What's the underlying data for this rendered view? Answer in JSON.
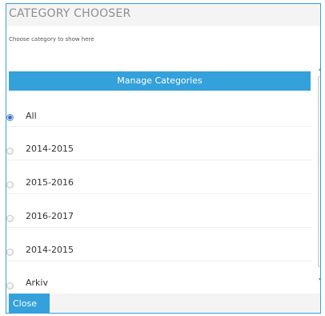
{
  "dialog": {
    "title": "CATEGORY CHOOSER",
    "subtitle": "Choose category to show here",
    "manage_label": "Manage Categories",
    "close_label": "Close"
  },
  "categories": [
    {
      "label": "All",
      "selected": true
    },
    {
      "label": "2014-2015",
      "selected": false
    },
    {
      "label": "2015-2016",
      "selected": false
    },
    {
      "label": "2016-2017",
      "selected": false
    },
    {
      "label": "2014-2015",
      "selected": false
    },
    {
      "label": "Arkiv",
      "selected": false
    }
  ],
  "colors": {
    "accent": "#34a1db",
    "title_text": "#8f8f8f",
    "header_bg": "#f4f4f4"
  }
}
